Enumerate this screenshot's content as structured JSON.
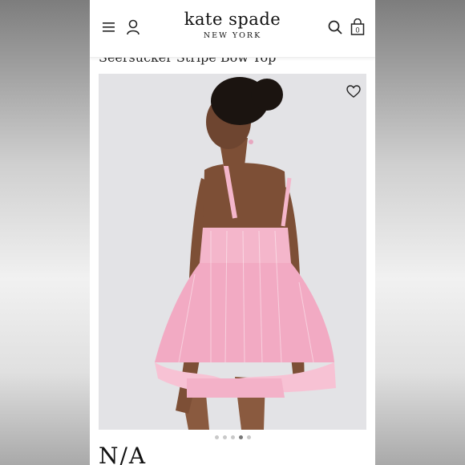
{
  "brand": {
    "name": "kate spade",
    "subtitle": "NEW YORK"
  },
  "header": {
    "menu_icon": "hamburger-menu-icon",
    "account_icon": "user-icon",
    "search_icon": "search-icon",
    "bag_icon": "shopping-bag-icon",
    "bag_count": "0"
  },
  "product": {
    "title": "Seersucker Stripe Bow Top",
    "price_partial": "N/A",
    "wishlist_icon": "heart-icon"
  },
  "carousel": {
    "total": 5,
    "active_index": 4
  },
  "colors": {
    "garment_pink": "#f4b6cb",
    "background": "#e3e3e6",
    "text": "#111111"
  }
}
